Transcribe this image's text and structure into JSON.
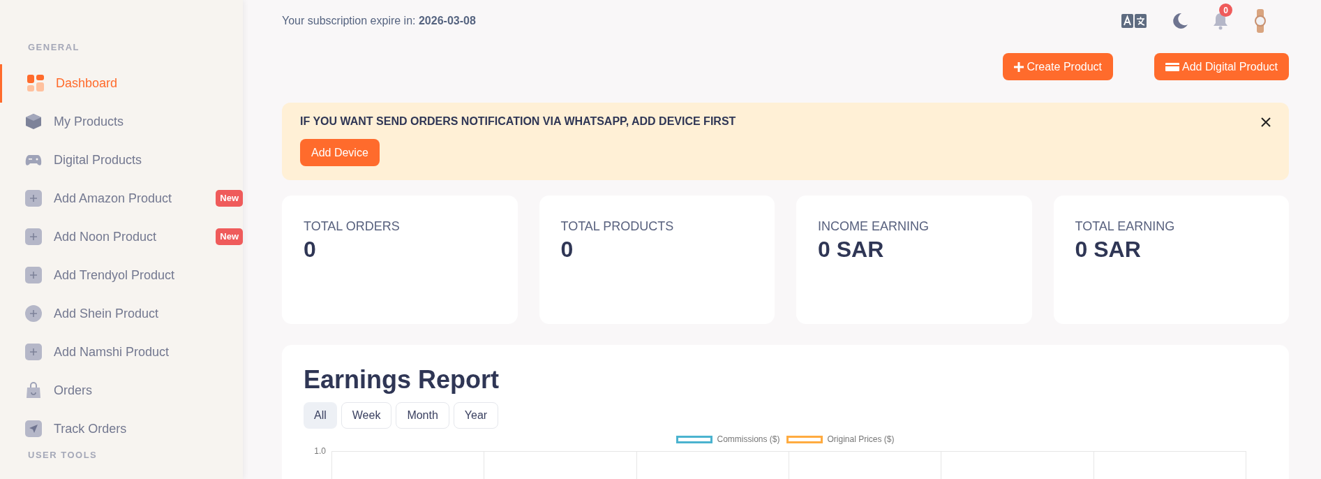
{
  "sidebar": {
    "sections": [
      {
        "title": "GENERAL",
        "items": [
          {
            "label": "Dashboard",
            "kind": "dashboard",
            "selected": true
          },
          {
            "label": "My Products",
            "kind": "box",
            "selected": false
          },
          {
            "label": "Digital Products",
            "kind": "gamepad",
            "selected": false
          },
          {
            "label": "Add Amazon Product",
            "kind": "plus-square",
            "selected": false,
            "badge": "New"
          },
          {
            "label": "Add Noon Product",
            "kind": "plus-square",
            "selected": false,
            "badge": "New"
          },
          {
            "label": "Add Trendyol Product",
            "kind": "plus-square",
            "selected": false
          },
          {
            "label": "Add Shein Product",
            "kind": "plus-circle",
            "selected": false
          },
          {
            "label": "Add Namshi Product",
            "kind": "plus-square",
            "selected": false
          },
          {
            "label": "Orders",
            "kind": "bag",
            "selected": false
          },
          {
            "label": "Track Orders",
            "kind": "send",
            "selected": false
          }
        ]
      },
      {
        "title": "USER TOOLS"
      }
    ]
  },
  "header": {
    "subscription_label": "Your subscription expire in: **2026-03-08**",
    "notification_count": "0"
  },
  "actions": [
    {
      "label": "Create Product",
      "kind": "plus"
    },
    {
      "label": "Add Digital Product",
      "kind": "card"
    }
  ],
  "alert": {
    "message": "IF YOU WANT SEND ORDERS NOTIFICATION VIA WHATSAPP, ADD DEVICE FIRST",
    "button": "Add Device"
  },
  "stats": [
    {
      "title": "TOTAL ORDERS",
      "value": "0"
    },
    {
      "title": "TOTAL PRODUCTS",
      "value": "0"
    },
    {
      "title": "INCOME EARNING",
      "value": "0 SAR"
    },
    {
      "title": "TOTAL EARNING",
      "value": "0 SAR"
    }
  ],
  "earnings": {
    "title": "Earnings Report",
    "periods": [
      {
        "label": "All",
        "selected": true
      },
      {
        "label": "Week",
        "selected": false
      },
      {
        "label": "Month",
        "selected": false
      },
      {
        "label": "Year",
        "selected": false
      }
    ],
    "legend": [
      {
        "name": "Commissions ($)",
        "color": "#4bb3cf"
      },
      {
        "name": "Original Prices ($)",
        "color": "#ffab40"
      }
    ],
    "y_tick_label": "1.0"
  }
}
